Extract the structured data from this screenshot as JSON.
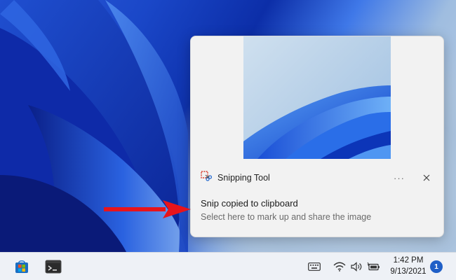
{
  "taskbar": {
    "apps": [
      {
        "name": "microsoft-store-icon"
      },
      {
        "name": "terminal-icon"
      }
    ],
    "tray_icons": [
      "keyboard-icon",
      "wifi-icon",
      "volume-icon",
      "battery-icon"
    ],
    "clock": {
      "time": "1:42 PM",
      "date": "9/13/2021"
    },
    "notification_count": "1",
    "accent_color": "#1f5fc7"
  },
  "toast": {
    "app_name": "Snipping Tool",
    "more_label": "···",
    "title": "Snip copied to clipboard",
    "body": "Select here to mark up and share the image"
  },
  "annotation": {
    "arrow_color": "#e8141b"
  }
}
